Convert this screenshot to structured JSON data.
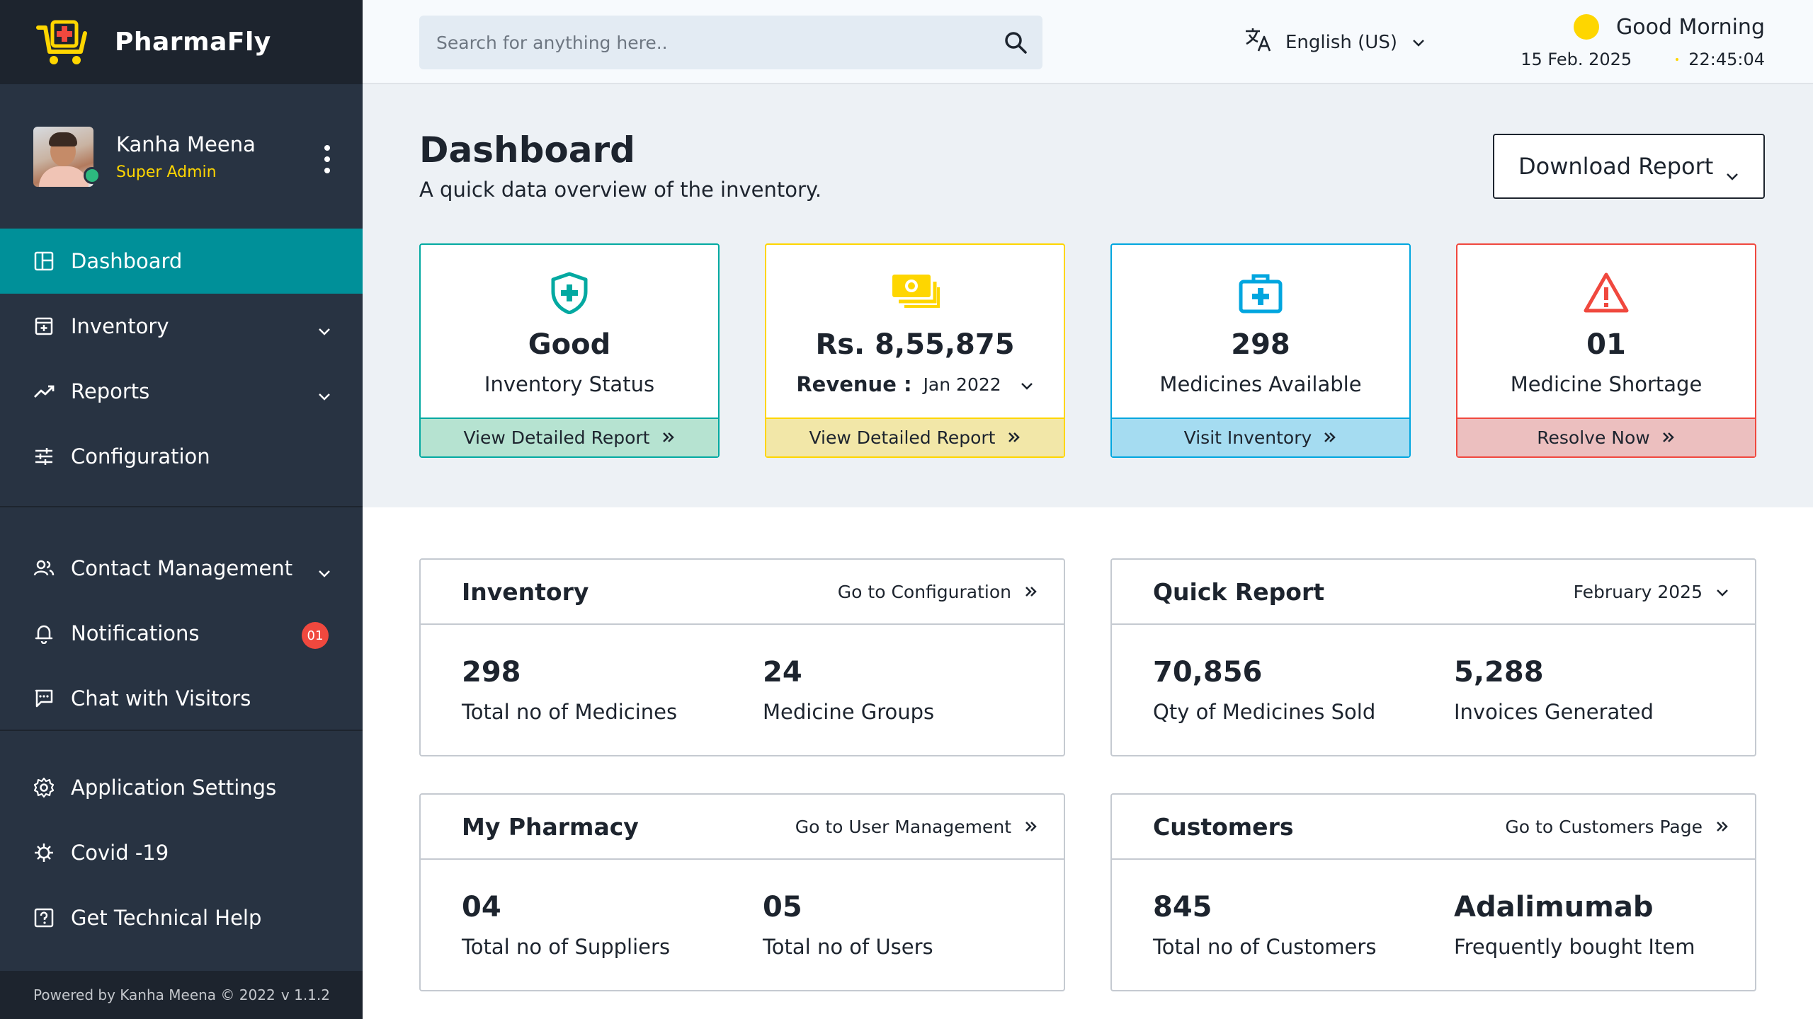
{
  "brand": {
    "name": "PharmaFly"
  },
  "user": {
    "name": "Kanha Meena",
    "role": "Super Admin"
  },
  "sidebar": {
    "items": [
      {
        "label": "Dashboard",
        "icon": "dashboard-icon",
        "active": true
      },
      {
        "label": "Inventory",
        "icon": "inventory-icon",
        "expandable": true
      },
      {
        "label": "Reports",
        "icon": "reports-icon",
        "expandable": true
      },
      {
        "label": "Configuration",
        "icon": "configuration-icon"
      },
      {
        "label": "Contact Management",
        "icon": "contacts-icon",
        "expandable": true
      },
      {
        "label": "Notifications",
        "icon": "bell-icon",
        "badge": "01"
      },
      {
        "label": "Chat with Visitors",
        "icon": "chat-icon"
      },
      {
        "label": "Application Settings",
        "icon": "settings-icon"
      },
      {
        "label": "Covid -19",
        "icon": "virus-icon"
      },
      {
        "label": "Get Technical Help",
        "icon": "help-icon"
      }
    ],
    "footer": {
      "powered_by": "Powered by Kanha Meena © 2022",
      "version": "v 1.1.2"
    }
  },
  "topbar": {
    "search_placeholder": "Search for anything here..",
    "language": "English (US)",
    "greeting": "Good Morning",
    "date": "15 Feb. 2025",
    "time": "22:45:04"
  },
  "header": {
    "title": "Dashboard",
    "subtitle": "A quick data overview of the inventory.",
    "download_label": "Download Report"
  },
  "stats": [
    {
      "value": "Good",
      "label": "Inventory Status",
      "action": "View Detailed Report",
      "color": "#03a9a1"
    },
    {
      "value": "Rs. 8,55,875",
      "label": "Revenue :",
      "month": "Jan 2022",
      "action": "View Detailed Report",
      "color": "#fed600"
    },
    {
      "value": "298",
      "label": "Medicines Available",
      "action": "Visit Inventory",
      "color": "#01a6df"
    },
    {
      "value": "01",
      "label": "Medicine Shortage",
      "action": "Resolve Now",
      "color": "#f0483e"
    }
  ],
  "panels": {
    "inventory": {
      "title": "Inventory",
      "link": "Go to Configuration",
      "metrics": [
        {
          "value": "298",
          "label": "Total no of Medicines"
        },
        {
          "value": "24",
          "label": "Medicine Groups"
        }
      ]
    },
    "quick_report": {
      "title": "Quick Report",
      "period": "February 2025",
      "metrics": [
        {
          "value": "70,856",
          "label": "Qty of Medicines Sold"
        },
        {
          "value": "5,288",
          "label": "Invoices Generated"
        }
      ]
    },
    "my_pharmacy": {
      "title": "My Pharmacy",
      "link": "Go to User Management",
      "metrics": [
        {
          "value": "04",
          "label": "Total no of Suppliers"
        },
        {
          "value": "05",
          "label": "Total no of Users"
        }
      ]
    },
    "customers": {
      "title": "Customers",
      "link": "Go to Customers Page",
      "metrics": [
        {
          "value": "845",
          "label": "Total no of Customers"
        },
        {
          "value": "Adalimumab",
          "label": "Frequently bought Item"
        }
      ]
    }
  }
}
